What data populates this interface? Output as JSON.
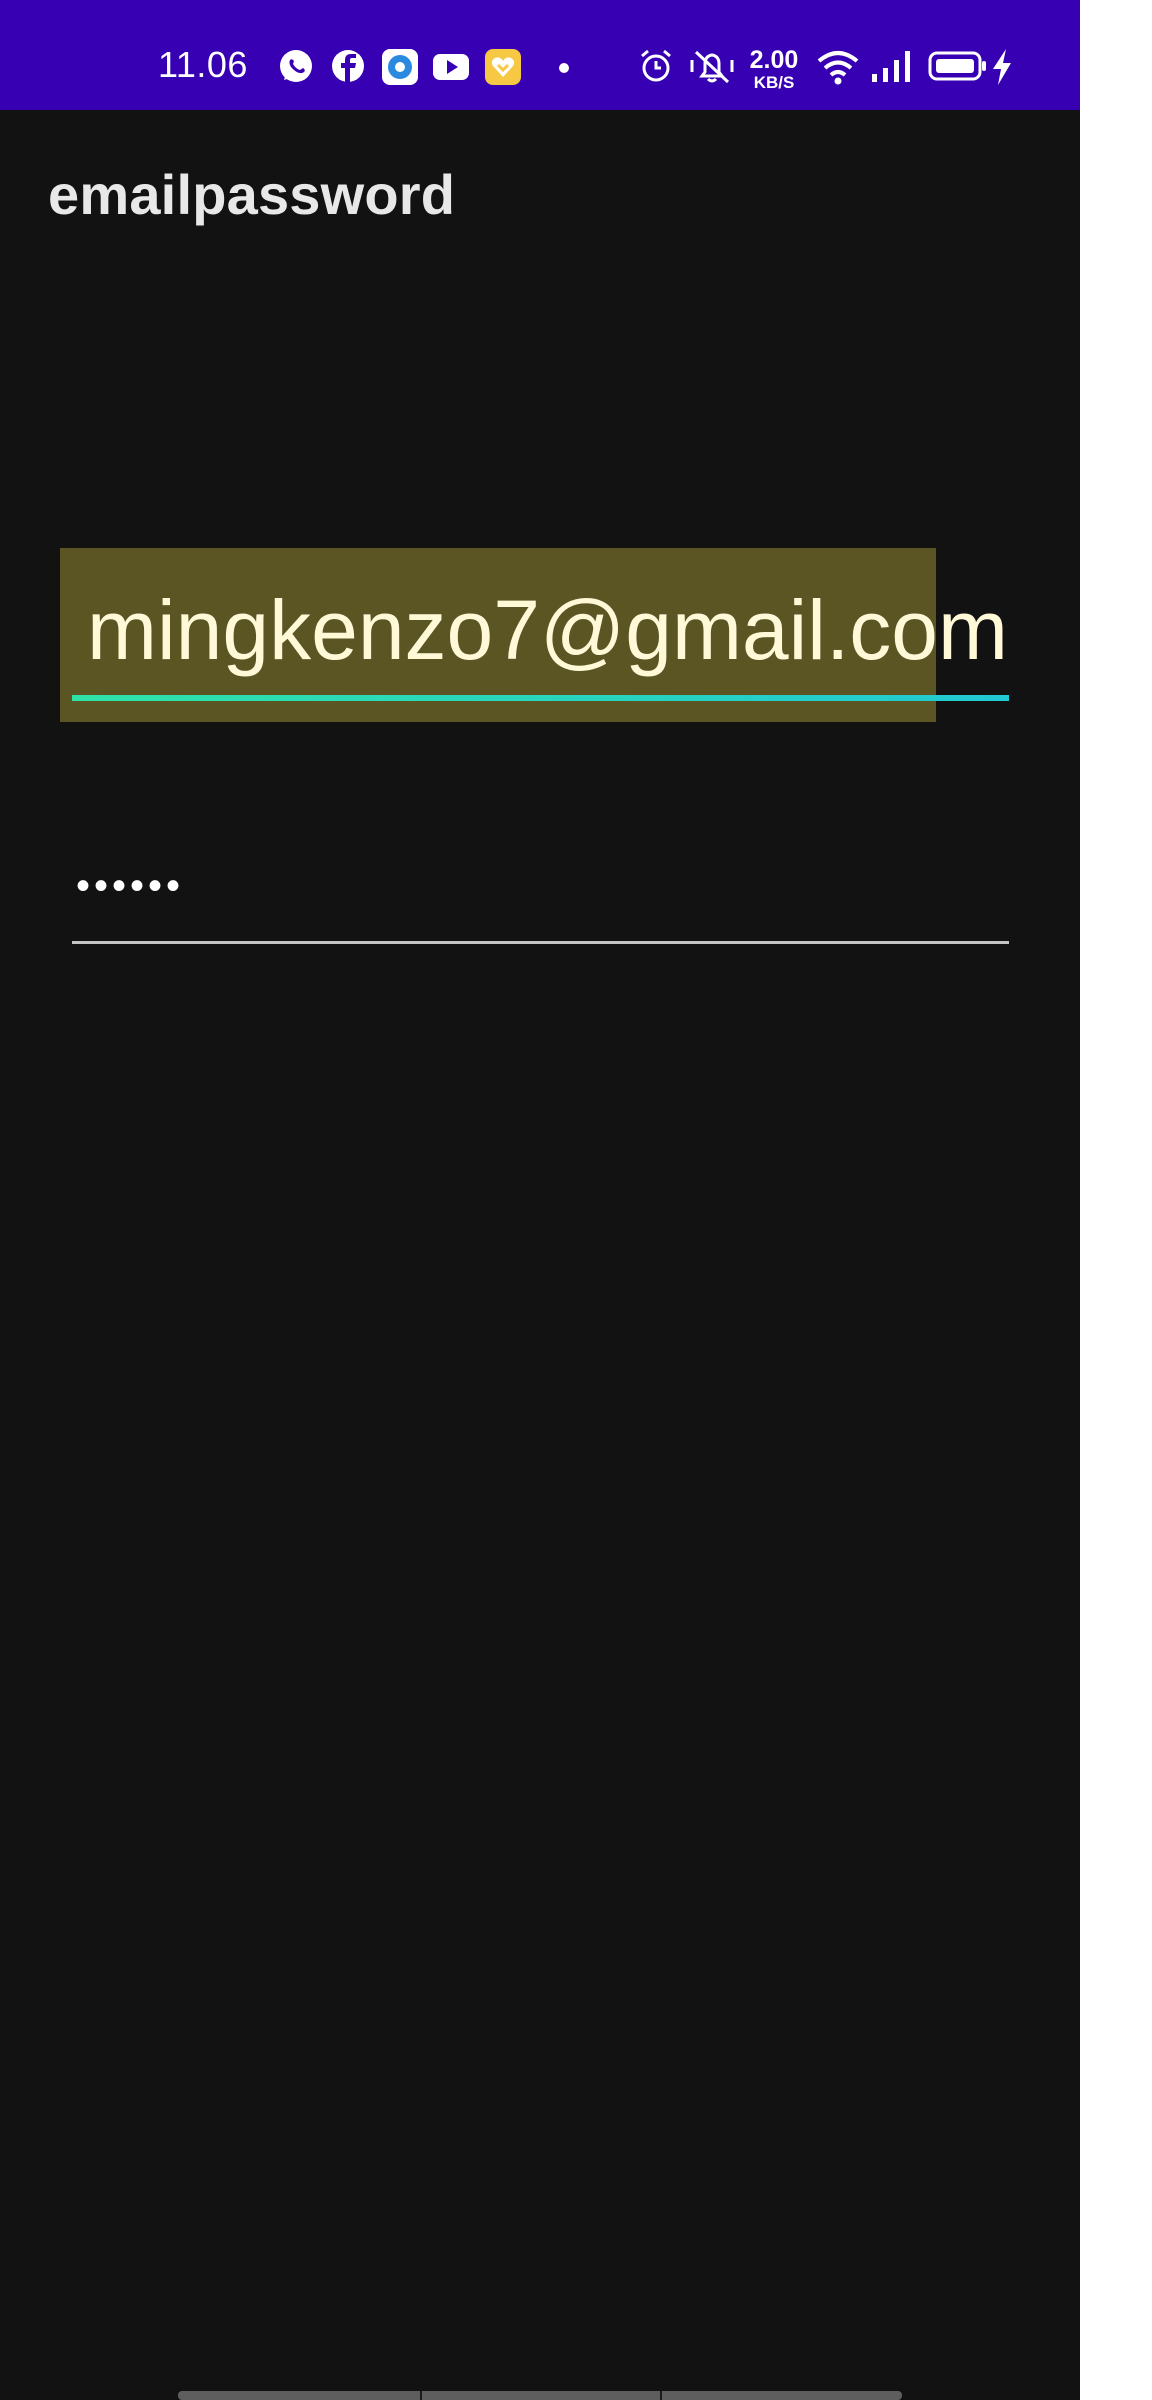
{
  "status_bar": {
    "time": "11.06",
    "net_speed_value": "2.00",
    "net_speed_unit": "KB/S",
    "background": "#3700b3",
    "icons": [
      "whatsapp-icon",
      "facebook-icon",
      "app-icon",
      "youtube-icon",
      "heart-app-icon",
      "notification-dot-icon",
      "alarm-icon",
      "vibrate-mute-icon",
      "wifi-icon",
      "signal-icon",
      "battery-icon",
      "charging-bolt-icon"
    ]
  },
  "app": {
    "title": "emailpassword",
    "background": "#121212"
  },
  "form": {
    "email_value": "mingkenzo7@gmail.com",
    "password_masked": "••••••",
    "accent_color": "#2fe2a8",
    "highlight_color": "#5b5524"
  }
}
